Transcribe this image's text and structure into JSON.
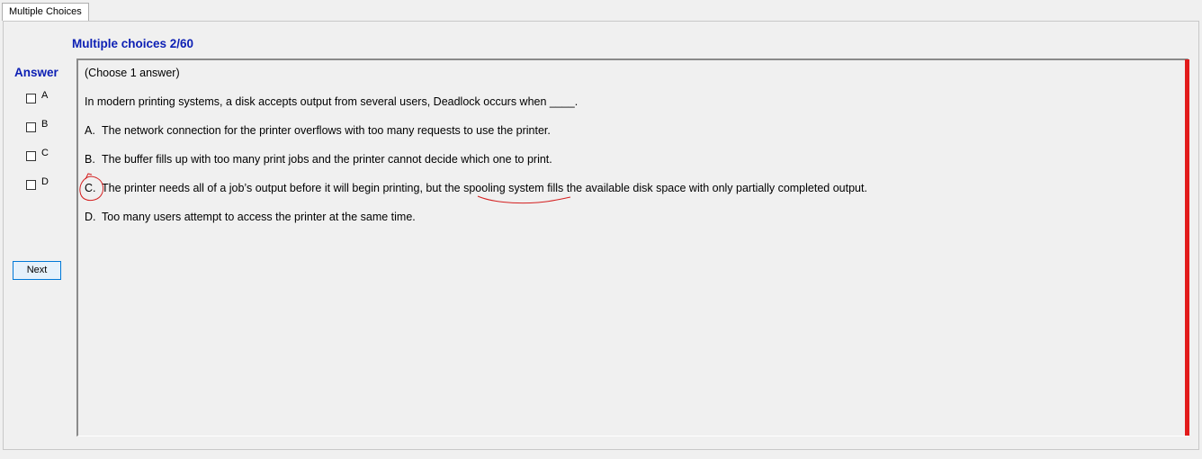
{
  "tab": {
    "label": "Multiple Choices"
  },
  "quiz": {
    "title": "Multiple choices 2/60"
  },
  "answer_panel": {
    "heading": "Answer",
    "choices": [
      {
        "label": "A",
        "checked": false
      },
      {
        "label": "B",
        "checked": false
      },
      {
        "label": "C",
        "checked": false
      },
      {
        "label": "D",
        "checked": false
      }
    ],
    "next_label": "Next"
  },
  "question": {
    "instruction": "(Choose 1 answer)",
    "text": "In modern printing systems, a disk accepts output from several users, Deadlock occurs when ____.",
    "options": [
      {
        "letter": "A.",
        "text": "The network connection for the printer overflows with too many requests to use the printer."
      },
      {
        "letter": "B.",
        "text": "The buffer fills up with too many print jobs and the printer cannot decide which one to print."
      },
      {
        "letter": "C.",
        "text": "The printer needs all of a job’s output before it will begin printing, but the spooling system fills the available disk space with only partially completed output."
      },
      {
        "letter": "D.",
        "text": "Too many users attempt to access the printer at the same time."
      }
    ]
  },
  "colors": {
    "heading_blue": "#0c1fb4",
    "accent_red": "#e21b1b",
    "background": "#f0f0f0"
  }
}
